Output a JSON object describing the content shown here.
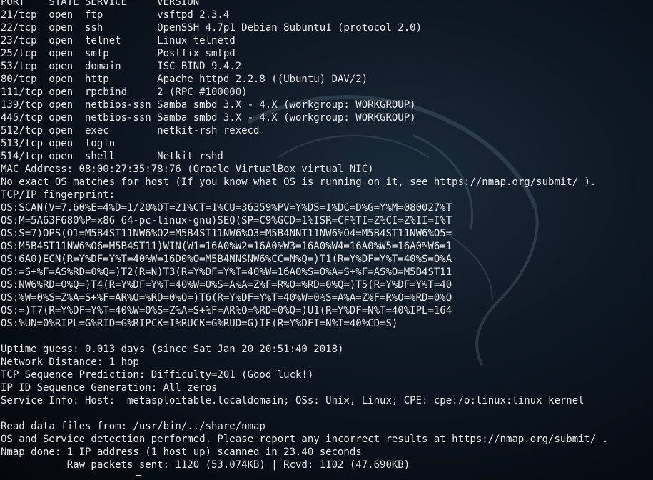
{
  "terminal": {
    "lines": [
      "PORT    STATE SERVICE     VERSION",
      "21/tcp  open  ftp         vsftpd 2.3.4",
      "22/tcp  open  ssh         OpenSSH 4.7p1 Debian 8ubuntu1 (protocol 2.0)",
      "23/tcp  open  telnet      Linux telnetd",
      "25/tcp  open  smtp        Postfix smtpd",
      "53/tcp  open  domain      ISC BIND 9.4.2",
      "80/tcp  open  http        Apache httpd 2.2.8 ((Ubuntu) DAV/2)",
      "111/tcp open  rpcbind     2 (RPC #100000)",
      "139/tcp open  netbios-ssn Samba smbd 3.X - 4.X (workgroup: WORKGROUP)",
      "445/tcp open  netbios-ssn Samba smbd 3.X - 4.X (workgroup: WORKGROUP)",
      "512/tcp open  exec        netkit-rsh rexecd",
      "513/tcp open  login",
      "514/tcp open  shell       Netkit rshd",
      "MAC Address: 08:00:27:35:78:76 (Oracle VirtualBox virtual NIC)",
      "No exact OS matches for host (If you know what OS is running on it, see https://nmap.org/submit/ ).",
      "TCP/IP fingerprint:",
      "OS:SCAN(V=7.60%E=4%D=1/20%OT=21%CT=1%CU=36359%PV=Y%DS=1%DC=D%G=Y%M=080027%T",
      "OS:M=5A63F680%P=x86_64-pc-linux-gnu)SEQ(SP=C9%GCD=1%ISR=CF%TI=Z%CI=Z%II=I%T",
      "OS:S=7)OPS(O1=M5B4ST11NW6%O2=M5B4ST11NW6%O3=M5B4NNT11NW6%O4=M5B4ST11NW6%O5=",
      "OS:M5B4ST11NW6%O6=M5B4ST11)WIN(W1=16A0%W2=16A0%W3=16A0%W4=16A0%W5=16A0%W6=1",
      "OS:6A0)ECN(R=Y%DF=Y%T=40%W=16D0%O=M5B4NNSNW6%CC=N%Q=)T1(R=Y%DF=Y%T=40%S=O%A",
      "OS:=S+%F=AS%RD=0%Q=)T2(R=N)T3(R=Y%DF=Y%T=40%W=16A0%S=O%A=S+%F=AS%O=M5B4ST11",
      "OS:NW6%RD=0%Q=)T4(R=Y%DF=Y%T=40%W=0%S=A%A=Z%F=R%O=%RD=0%Q=)T5(R=Y%DF=Y%T=40",
      "OS:%W=0%S=Z%A=S+%F=AR%O=%RD=0%Q=)T6(R=Y%DF=Y%T=40%W=0%S=A%A=Z%F=R%O=%RD=0%Q",
      "OS:=)T7(R=Y%DF=Y%T=40%W=0%S=Z%A=S+%F=AR%O=%RD=0%Q=)U1(R=Y%DF=N%T=40%IPL=164",
      "OS:%UN=0%RIPL=G%RID=G%RIPCK=I%RUCK=G%RUD=G)IE(R=Y%DFI=N%T=40%CD=S)",
      "",
      "Uptime guess: 0.013 days (since Sat Jan 20 20:51:40 2018)",
      "Network Distance: 1 hop",
      "TCP Sequence Prediction: Difficulty=201 (Good luck!)",
      "IP ID Sequence Generation: All zeros",
      "Service Info: Host:  metasploitable.localdomain; OSs: Unix, Linux; CPE: cpe:/o:linux:linux_kernel",
      "",
      "Read data files from: /usr/bin/../share/nmap",
      "OS and Service detection performed. Please report any incorrect results at https://nmap.org/submit/ .",
      "Nmap done: 1 IP address (1 host up) scanned in 23.40 seconds",
      "           Raw packets sent: 1120 (53.074KB) | Rcvd: 1102 (47.690KB)"
    ]
  },
  "icons": {
    "watermark": "kali-dragon-icon"
  }
}
